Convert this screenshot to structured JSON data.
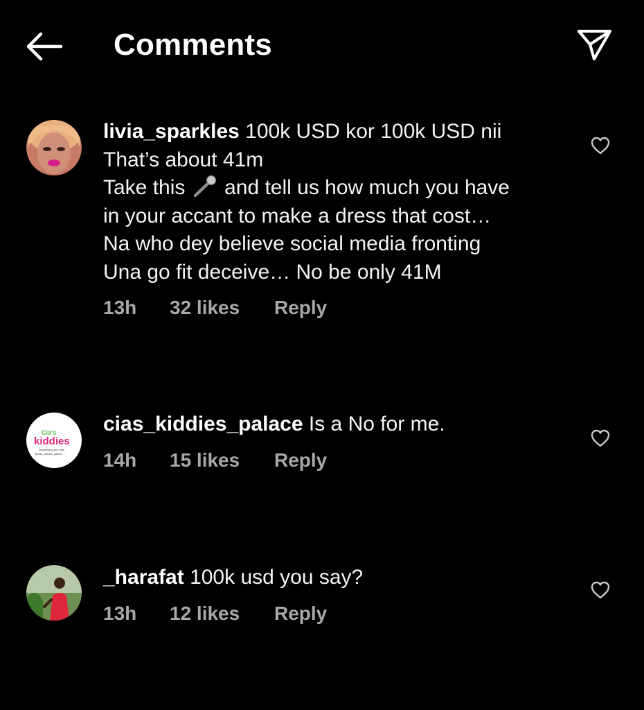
{
  "header": {
    "title": "Comments"
  },
  "comments": [
    {
      "username": "livia_sparkles",
      "lines": [
        "100k USD kor 100k USD nii",
        "That’s about 41m",
        "Take this",
        "and tell us how much you have",
        "in your accant to make a dress that cost…",
        "Na who dey believe social media fronting",
        "Una go fit deceive… No be only 41M"
      ],
      "time": "13h",
      "likes": "32 likes",
      "reply": "Reply"
    },
    {
      "username": "cias_kiddies_palace",
      "text": "Is a No for me.",
      "time": "14h",
      "likes": "15 likes",
      "reply": "Reply"
    },
    {
      "username": "_harafat",
      "text": "100k usd you say?",
      "time": "13h",
      "likes": "12 likes",
      "reply": "Reply"
    }
  ],
  "avatar_logo": {
    "line1": "Cia's",
    "line2": "kiddies",
    "line3": "Beautifying your kids",
    "line4": "@cias_kiddies_palace"
  },
  "icons": {
    "back": "arrow-left-icon",
    "share": "paper-plane-icon",
    "like": "heart-outline-icon",
    "emoji": "microphone-emoji"
  },
  "colors": {
    "background": "#000000",
    "text": "#ffffff",
    "meta": "#a8a8a8"
  }
}
